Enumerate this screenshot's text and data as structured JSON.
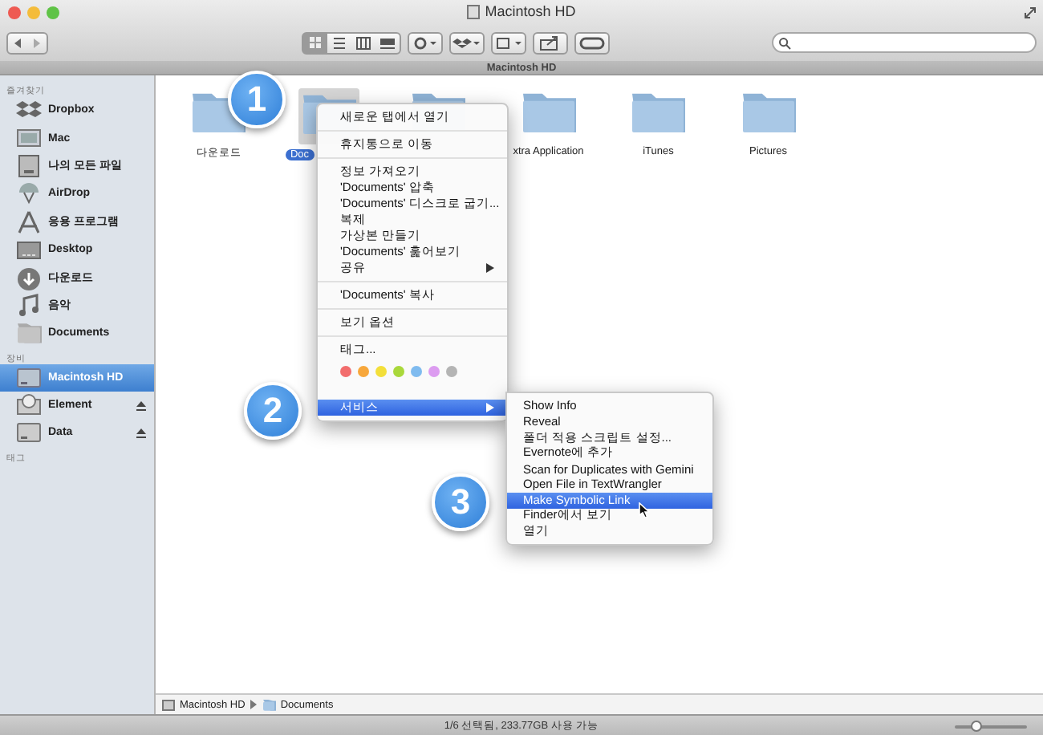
{
  "window": {
    "title": "Macintosh HD"
  },
  "tab_bar": {
    "label": "Macintosh HD"
  },
  "sidebar": [
    {
      "heading": "즐겨찾기",
      "items": [
        {
          "label": "Dropbox",
          "selected": false,
          "ejectable": false
        },
        {
          "label": "Mac",
          "selected": false,
          "ejectable": false
        },
        {
          "label": "나의 모든 파일",
          "selected": false,
          "ejectable": false
        },
        {
          "label": "AirDrop",
          "selected": false,
          "ejectable": false
        },
        {
          "label": "응용 프로그램",
          "selected": false,
          "ejectable": false
        },
        {
          "label": "Desktop",
          "selected": false,
          "ejectable": false
        },
        {
          "label": "다운로드",
          "selected": false,
          "ejectable": false
        },
        {
          "label": "음악",
          "selected": false,
          "ejectable": false
        },
        {
          "label": "Documents",
          "selected": false,
          "ejectable": false
        }
      ]
    },
    {
      "heading": "장비",
      "items": [
        {
          "label": "Macintosh HD",
          "selected": true,
          "ejectable": false
        },
        {
          "label": "Element",
          "selected": false,
          "ejectable": true
        },
        {
          "label": "Data",
          "selected": false,
          "ejectable": true
        }
      ]
    },
    {
      "heading": "태그"
    }
  ],
  "files": [
    {
      "kind": "folder",
      "label": "다운로드",
      "selected": false
    },
    {
      "kind": "folder",
      "label": "Doc",
      "selected": true
    },
    {
      "kind": "dropbox-folder",
      "selected": false
    },
    {
      "kind": "folder",
      "label": "xtra Application",
      "selected": false
    },
    {
      "kind": "folder",
      "label": "iTunes",
      "selected": false
    },
    {
      "kind": "folder",
      "label": "Pictures",
      "selected": false
    }
  ],
  "context_menu": [
    {
      "kind": "item",
      "label": "새로운 탭에서 열기",
      "submenu": false,
      "selected": false
    },
    {
      "kind": "separator"
    },
    {
      "kind": "item",
      "label": "휴지통으로 이동",
      "submenu": false,
      "selected": false
    },
    {
      "kind": "separator"
    },
    {
      "kind": "item",
      "label": "정보 가져오기",
      "submenu": false,
      "selected": false
    },
    {
      "kind": "item",
      "label": "'Documents' 압축",
      "submenu": false,
      "selected": false
    },
    {
      "kind": "item",
      "label": "'Documents' 디스크로 굽기...",
      "submenu": false,
      "selected": false
    },
    {
      "kind": "item",
      "label": "복제",
      "submenu": false,
      "selected": false
    },
    {
      "kind": "item",
      "label": "가상본 만들기",
      "submenu": false,
      "selected": false
    },
    {
      "kind": "item",
      "label": "'Documents' 훑어보기",
      "submenu": false,
      "selected": false
    },
    {
      "kind": "item",
      "label": "공유",
      "submenu": true,
      "selected": false
    },
    {
      "kind": "separator"
    },
    {
      "kind": "item",
      "label": "'Documents' 복사",
      "submenu": false,
      "selected": false
    },
    {
      "kind": "separator"
    },
    {
      "kind": "item",
      "label": "보기 옵션",
      "submenu": false,
      "selected": false
    },
    {
      "kind": "separator"
    },
    {
      "kind": "item",
      "label": "태그...",
      "submenu": false,
      "selected": false
    },
    {
      "kind": "tags",
      "tags": [
        {
          "color": "#f26d6d"
        },
        {
          "color": "#f7a73b"
        },
        {
          "color": "#f3df3a"
        },
        {
          "color": "#a9d83b"
        },
        {
          "color": "#7fbbef"
        },
        {
          "color": "#dc9cf0"
        },
        {
          "color": "#b4b4b4"
        }
      ]
    },
    {
      "kind": "item",
      "label": "서비스",
      "submenu": true,
      "selected": true
    }
  ],
  "services_menu": [
    {
      "label": "Show Info",
      "selected": false
    },
    {
      "label": "Reveal",
      "selected": false
    },
    {
      "label": "폴더 적용 스크립트 설정...",
      "selected": false
    },
    {
      "label": "Evernote에 추가",
      "selected": false
    },
    {
      "label": "Scan for Duplicates with Gemini",
      "selected": false
    },
    {
      "label": "Open File in TextWrangler",
      "selected": false
    },
    {
      "label": "Make Symbolic Link",
      "selected": true
    },
    {
      "label": "Finder에서 보기",
      "selected": false
    },
    {
      "label": "열기",
      "selected": false
    }
  ],
  "callouts": [
    "1",
    "2",
    "3"
  ],
  "path_bar": [
    {
      "label": "Macintosh HD"
    },
    {
      "label": "Documents"
    }
  ],
  "status_bar": {
    "text": "1/6 선택됨, 233.77GB 사용 가능",
    "zoom": {
      "level": 0.3
    }
  }
}
